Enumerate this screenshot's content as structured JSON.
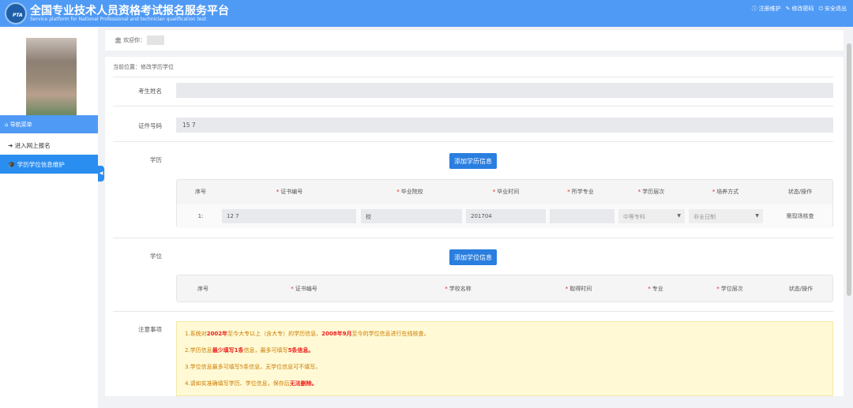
{
  "header": {
    "title": "全国专业技术人员资格考试报名服务平台",
    "subtitle": "Service platform for National Professional and technician qualification test",
    "logo_text": "PTA",
    "links": [
      {
        "icon": "info-icon",
        "label": "注册维护"
      },
      {
        "icon": "edit-icon",
        "label": "修改密码"
      },
      {
        "icon": "power-icon",
        "label": "安全退出"
      }
    ]
  },
  "sidebar": {
    "nav_title": "导航菜单",
    "items": [
      {
        "icon": "signin-icon",
        "label": "进入网上报名"
      },
      {
        "icon": "graduation-cap-icon",
        "label": "学历学位信息维护"
      }
    ]
  },
  "welcome": {
    "label": "欢迎你："
  },
  "breadcrumb": "当前位置：修改学历学位",
  "form": {
    "name_label": "考生姓名",
    "name_value": "",
    "id_label": "证件号码",
    "id_value": "15                              7",
    "education_label": "学历",
    "add_education_button": "添加学历信息",
    "degree_label": "学位",
    "add_degree_button": "添加学位信息",
    "notes_label": "注意事项"
  },
  "education_table": {
    "headers": [
      {
        "text": "序号",
        "required": false
      },
      {
        "text": "证书编号",
        "required": true
      },
      {
        "text": "毕业院校",
        "required": true
      },
      {
        "text": "毕业时间",
        "required": true
      },
      {
        "text": "所学专业",
        "required": true
      },
      {
        "text": "学历层次",
        "required": true
      },
      {
        "text": "培养方式",
        "required": true
      },
      {
        "text": "状态/操作",
        "required": false
      }
    ],
    "rows": [
      {
        "index": "1:",
        "cert_no": "12                   7",
        "school": "                          校",
        "grad_time": "201704",
        "major": "",
        "level": "中等专科",
        "mode": "非全日制",
        "status": "需现场核查"
      }
    ]
  },
  "degree_table": {
    "headers": [
      {
        "text": "序号",
        "required": false
      },
      {
        "text": "证书编号",
        "required": true
      },
      {
        "text": "学校名称",
        "required": true
      },
      {
        "text": "取得时间",
        "required": true
      },
      {
        "text": "专业",
        "required": true
      },
      {
        "text": "学位层次",
        "required": true
      },
      {
        "text": "状态/操作",
        "required": false
      }
    ]
  },
  "notes": [
    {
      "p1": "1.系统对",
      "h1": "2002年",
      "p2": "至今大专以上（含大专）的学历信息、",
      "h2": "2008年9月",
      "p3": "至今的学位信息进行在线核查。"
    },
    {
      "p1": "2.学历信息",
      "h1": "最少填写1条",
      "p2": "信息，最多可填写",
      "h2": "5条信息。",
      "p3": ""
    },
    {
      "p1": "3.学位信息最多可填写5条信息，无学位信息可不填写。",
      "h1": "",
      "p2": "",
      "h2": "",
      "p3": ""
    },
    {
      "p1": "4.请如实准确填写学历、学位信息，保存后",
      "h1": "无法删除。",
      "p2": "",
      "h2": "",
      "p3": ""
    }
  ],
  "colors": {
    "header": "#4f9af5",
    "button": "#2a7ee0",
    "notes_bg": "#fffad5",
    "highlight": "#ee1c1c"
  }
}
